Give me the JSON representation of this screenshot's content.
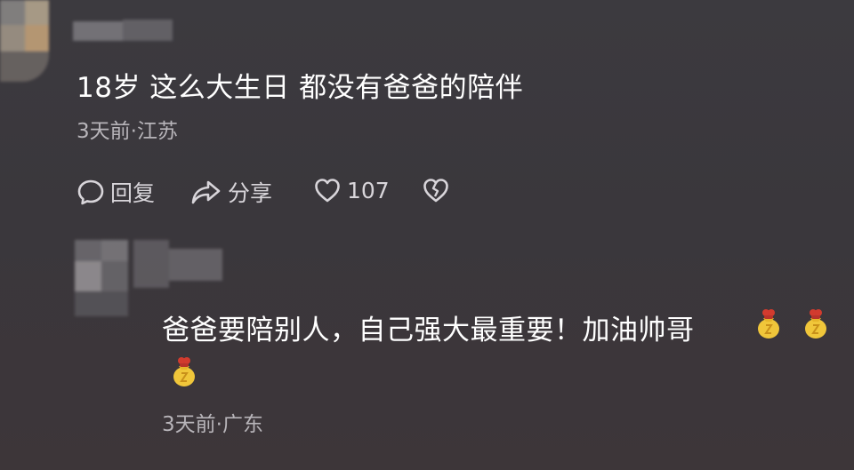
{
  "comment1": {
    "text": "18岁 这么大生日 都没有爸爸的陪伴",
    "meta": "3天前·江苏",
    "actions": {
      "reply_label": "回复",
      "share_label": "分享",
      "like_count": "107"
    }
  },
  "comment2": {
    "text": "爸爸要陪别人，自己强大最重要！加油帅哥",
    "meta": "3天前·广东",
    "emoji_name": "bag-of-money-icon"
  },
  "colors": {
    "background": "#3a373c",
    "text_primary": "#ffffff",
    "text_secondary": "#b7b4b9",
    "action": "#d8d5da"
  }
}
